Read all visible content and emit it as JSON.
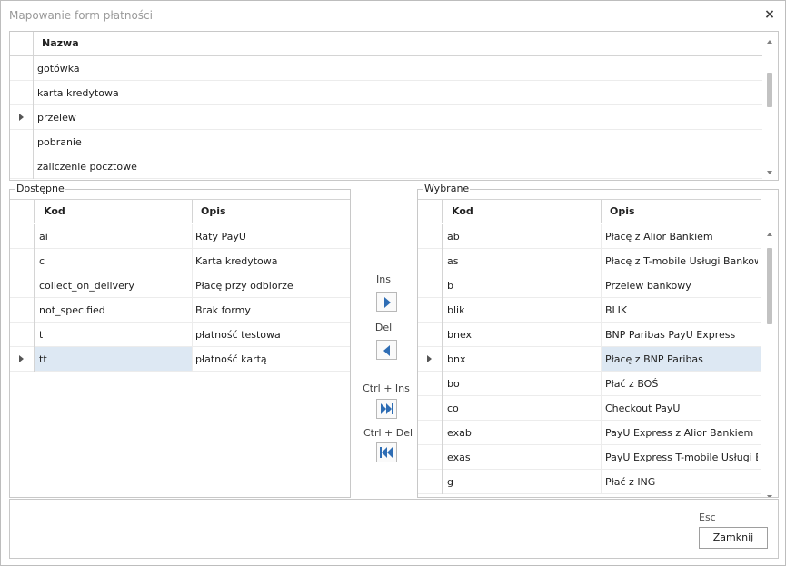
{
  "window": {
    "title": "Mapowanie form płatności",
    "close_glyph": "×"
  },
  "top_grid": {
    "column_header": "Nazwa",
    "rows": [
      "gotówka",
      "karta kredytowa",
      "przelew",
      "pobranie",
      "zaliczenie pocztowe"
    ],
    "current_row_index": 2
  },
  "available": {
    "legend": "Dostępne",
    "columns": [
      "Kod",
      "Opis"
    ],
    "rows": [
      {
        "kod": "ai",
        "opis": "Raty PayU"
      },
      {
        "kod": "c",
        "opis": "Karta kredytowa"
      },
      {
        "kod": "collect_on_delivery",
        "opis": "Płacę przy odbiorze"
      },
      {
        "kod": "not_specified",
        "opis": "Brak formy"
      },
      {
        "kod": "t",
        "opis": "płatność testowa"
      },
      {
        "kod": "tt",
        "opis": "płatność kartą"
      }
    ],
    "current_row_index": 5
  },
  "selected": {
    "legend": "Wybrane",
    "columns": [
      "Kod",
      "Opis"
    ],
    "rows": [
      {
        "kod": "ab",
        "opis": "Płacę z Alior Bankiem"
      },
      {
        "kod": "as",
        "opis": "Płacę z T-mobile Usługi Bankowe…"
      },
      {
        "kod": "b",
        "opis": "Przelew bankowy"
      },
      {
        "kod": "blik",
        "opis": "BLIK"
      },
      {
        "kod": "bnex",
        "opis": "BNP Paribas PayU Express"
      },
      {
        "kod": "bnx",
        "opis": "Płacę z BNP Paribas"
      },
      {
        "kod": "bo",
        "opis": "Płać z BOŚ"
      },
      {
        "kod": "co",
        "opis": "Checkout PayU"
      },
      {
        "kod": "exab",
        "opis": "PayU Express z Alior Bankiem"
      },
      {
        "kod": "exas",
        "opis": "PayU Express T-mobile Usługi Ba…"
      },
      {
        "kod": "g",
        "opis": "Płać z ING"
      }
    ],
    "current_row_index": 5
  },
  "middle": {
    "ins_label": "Ins",
    "del_label": "Del",
    "ctrl_ins_label": "Ctrl + Ins",
    "ctrl_del_label": "Ctrl + Del"
  },
  "footer": {
    "esc_label": "Esc",
    "close_label": "Zamknij"
  },
  "icons": {
    "add": "arrow-right-icon",
    "remove": "arrow-left-icon",
    "add_all": "double-arrow-right-icon",
    "remove_all": "double-arrow-left-icon"
  },
  "colors": {
    "accent": "#2e6db4",
    "selection": "#dde8f3",
    "title": "#9a9a9a"
  }
}
